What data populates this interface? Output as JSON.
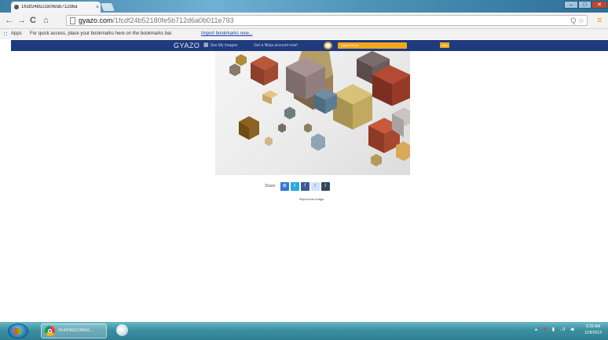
{
  "browser": {
    "tab_title": "1fcdf24b52180fe5b712d6a",
    "tab_close": "×",
    "window": {
      "minimize": "–",
      "maximize": "□",
      "close": "✕"
    },
    "nav": {
      "back": "←",
      "forward": "→",
      "reload": "C",
      "home": "⌂"
    },
    "url": {
      "host": "gyazo.com",
      "path": "/1fcdf24b52180fe5b712d6a0b011e793"
    },
    "omnibox_icons": {
      "search": "Q",
      "star": "☆"
    },
    "menu": "≡"
  },
  "bookmarks": {
    "apps_label": "Apps",
    "message": "For quick access, place your bookmarks here on the bookmarks bar.",
    "import_link": "Import bookmarks now..."
  },
  "gyazo": {
    "logo": "GYAZO",
    "grid_icon": "▦",
    "see_my_images": "See My Images",
    "get_ninja": "Get a Ninja account now!",
    "promo_label": "Gyazo Pro ●",
    "like_label": "Like"
  },
  "share": {
    "label": "Share:",
    "buttons": [
      {
        "name": "delicious",
        "glyph": "⊞",
        "color": "#3274d1"
      },
      {
        "name": "twitter",
        "glyph": "t",
        "color": "#2aa9e0"
      },
      {
        "name": "facebook",
        "glyph": "f",
        "color": "#3b5998"
      },
      {
        "name": "reddit",
        "glyph": "r",
        "color": "#cee3f8"
      },
      {
        "name": "tumblr",
        "glyph": "t",
        "color": "#35465c"
      }
    ],
    "report": "Report this image"
  },
  "taskbar": {
    "task_label": "1fcdf24b52180fe5...",
    "tray": {
      "up": "▴",
      "flag": "⚑",
      "battery": "▮",
      "signal": "..ıl",
      "volume": "◀"
    },
    "clock_time": "9:25 AM",
    "clock_date": "11/8/2013"
  }
}
